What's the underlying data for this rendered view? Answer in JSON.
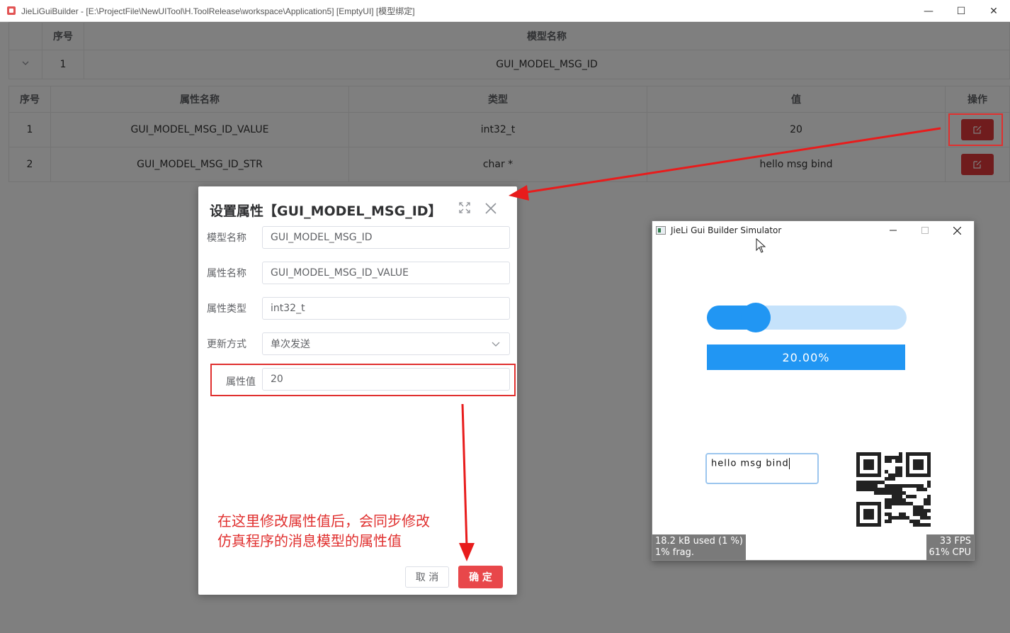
{
  "window": {
    "title": "JieLiGuiBuilder - [E:\\ProjectFile\\NewUITool\\H.ToolRelease\\workspace\\Application5] [EmptyUI] [模型绑定]",
    "minimize": "—",
    "maximize": "☐",
    "close": "✕"
  },
  "model_table": {
    "headers": [
      "序号",
      "模型名称"
    ],
    "rows": [
      {
        "index": "1",
        "name": "GUI_MODEL_MSG_ID"
      }
    ]
  },
  "attr_table": {
    "headers": [
      "序号",
      "属性名称",
      "类型",
      "值",
      "操作"
    ],
    "rows": [
      {
        "index": "1",
        "name": "GUI_MODEL_MSG_ID_VALUE",
        "type": "int32_t",
        "value": "20"
      },
      {
        "index": "2",
        "name": "GUI_MODEL_MSG_ID_STR",
        "type": "char *",
        "value": "hello msg bind"
      }
    ]
  },
  "dialog": {
    "title": "设置属性【GUI_MODEL_MSG_ID】",
    "fields": {
      "model_name": {
        "label": "模型名称",
        "value": "GUI_MODEL_MSG_ID"
      },
      "attr_name": {
        "label": "属性名称",
        "value": "GUI_MODEL_MSG_ID_VALUE"
      },
      "attr_type": {
        "label": "属性类型",
        "value": "int32_t"
      },
      "update_mode": {
        "label": "更新方式",
        "value": "单次发送"
      },
      "attr_value": {
        "label": "属性值",
        "value": "20"
      }
    },
    "annotation_line1": "在这里修改属性值后，会同步修改",
    "annotation_line2": "仿真程序的消息模型的属性值",
    "cancel_label": "取 消",
    "ok_label": "确 定"
  },
  "simulator": {
    "title": "JieLi Gui Builder Simulator",
    "slider_value": 0.2,
    "bar_label": "20.00%",
    "textarea_text": "hello msg bind",
    "mem_line1": "18.2 kB used (1 %)",
    "mem_line2": "1% frag.",
    "fps": "33 FPS",
    "cpu": "61% CPU"
  },
  "colors": {
    "accent_red": "#e0393b",
    "sim_blue": "#2196f3",
    "annotation_red": "#e0302f"
  }
}
